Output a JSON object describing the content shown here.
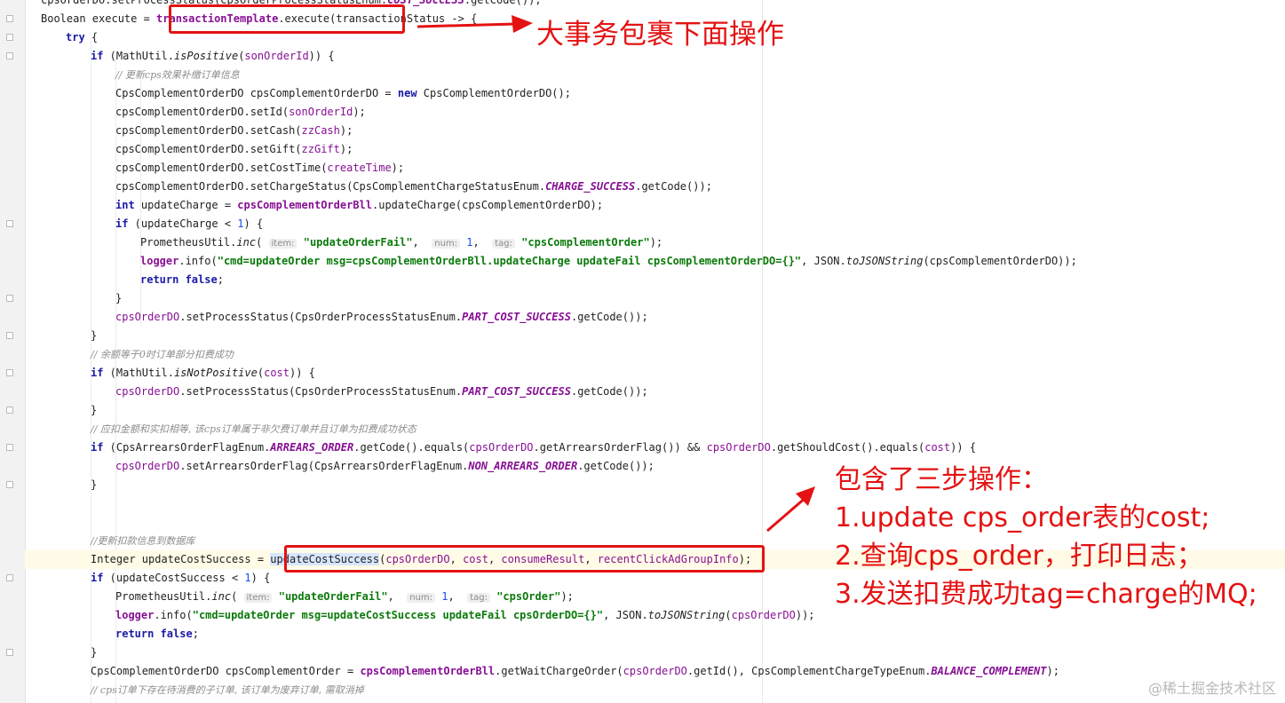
{
  "editor": {
    "lines": [
      {
        "id": "l0",
        "indent": 0,
        "parts": [
          [
            "",
            "cpsOrderDO.setProcessStatus(CpsOrderProcessStatusEnum."
          ],
          [
            "cst",
            "COST_SUCCESS"
          ],
          [
            "",
            ".getCode());"
          ]
        ]
      },
      {
        "id": "l1",
        "indent": 0,
        "parts": [
          [
            "",
            "Boolean execute = "
          ],
          [
            "mem",
            "transactionTemplate"
          ],
          [
            "",
            ".execute(transactionStatus -> {"
          ]
        ]
      },
      {
        "id": "l2",
        "indent": 1,
        "parts": [
          [
            "kw",
            "try"
          ],
          [
            "",
            " {"
          ]
        ]
      },
      {
        "id": "l3",
        "indent": 2,
        "parts": [
          [
            "kw",
            "if"
          ],
          [
            "",
            " (MathUtil."
          ],
          [
            "ita",
            "isPositive"
          ],
          [
            "",
            "("
          ],
          [
            "fld",
            "sonOrderId"
          ],
          [
            "",
            ")) {"
          ]
        ]
      },
      {
        "id": "l4",
        "indent": 3,
        "parts": [
          [
            "cm",
            "// 更新cps效果补缴订单信息"
          ]
        ]
      },
      {
        "id": "l5",
        "indent": 3,
        "parts": [
          [
            "",
            "CpsComplementOrderDO cpsComplementOrderDO = "
          ],
          [
            "kw",
            "new"
          ],
          [
            "",
            " CpsComplementOrderDO();"
          ]
        ]
      },
      {
        "id": "l6",
        "indent": 3,
        "parts": [
          [
            "",
            "cpsComplementOrderDO.setId("
          ],
          [
            "fld",
            "sonOrderId"
          ],
          [
            "",
            ");"
          ]
        ]
      },
      {
        "id": "l7",
        "indent": 3,
        "parts": [
          [
            "",
            "cpsComplementOrderDO.setCash("
          ],
          [
            "fld",
            "zzCash"
          ],
          [
            "",
            ");"
          ]
        ]
      },
      {
        "id": "l8",
        "indent": 3,
        "parts": [
          [
            "",
            "cpsComplementOrderDO.setGift("
          ],
          [
            "fld",
            "zzGift"
          ],
          [
            "",
            ");"
          ]
        ]
      },
      {
        "id": "l9",
        "indent": 3,
        "parts": [
          [
            "",
            "cpsComplementOrderDO.setCostTime("
          ],
          [
            "fld",
            "createTime"
          ],
          [
            "",
            ");"
          ]
        ]
      },
      {
        "id": "l10",
        "indent": 3,
        "parts": [
          [
            "",
            "cpsComplementOrderDO.setChargeStatus(CpsComplementChargeStatusEnum."
          ],
          [
            "cst",
            "CHARGE_SUCCESS"
          ],
          [
            "",
            ".getCode());"
          ]
        ]
      },
      {
        "id": "l11",
        "indent": 3,
        "parts": [
          [
            "kw",
            "int"
          ],
          [
            "",
            " updateCharge = "
          ],
          [
            "mem",
            "cpsComplementOrderBll"
          ],
          [
            "",
            ".updateCharge(cpsComplementOrderDO);"
          ]
        ]
      },
      {
        "id": "l12",
        "indent": 3,
        "parts": [
          [
            "kw",
            "if"
          ],
          [
            "",
            " (updateCharge < "
          ],
          [
            "num",
            "1"
          ],
          [
            "",
            ") {"
          ]
        ]
      },
      {
        "id": "l13",
        "indent": 4,
        "parts": [
          [
            "",
            "PrometheusUtil."
          ],
          [
            "ita",
            "inc"
          ],
          [
            "",
            "( "
          ],
          [
            "hint",
            "item:"
          ],
          [
            "",
            " "
          ],
          [
            "str",
            "\"updateOrderFail\""
          ],
          [
            "",
            ",  "
          ],
          [
            "hint",
            "num:"
          ],
          [
            "",
            " "
          ],
          [
            "num",
            "1"
          ],
          [
            "",
            ",  "
          ],
          [
            "hint",
            "tag:"
          ],
          [
            "",
            " "
          ],
          [
            "str",
            "\"cpsComplementOrder\""
          ],
          [
            "",
            ");"
          ]
        ]
      },
      {
        "id": "l14",
        "indent": 4,
        "parts": [
          [
            "mem",
            "logger"
          ],
          [
            "",
            ".info("
          ],
          [
            "str",
            "\"cmd=updateOrder msg=cpsComplementOrderBll.updateCharge updateFail cpsComplementOrderDO={}\""
          ],
          [
            "",
            ", JSON."
          ],
          [
            "ita",
            "toJSONString"
          ],
          [
            "",
            "(cpsComplementOrderDO));"
          ]
        ]
      },
      {
        "id": "l15",
        "indent": 4,
        "parts": [
          [
            "kw",
            "return false"
          ],
          [
            "",
            ";"
          ]
        ]
      },
      {
        "id": "l16",
        "indent": 3,
        "parts": [
          [
            "",
            "}"
          ]
        ]
      },
      {
        "id": "l17",
        "indent": 3,
        "parts": [
          [
            "fld",
            "cpsOrderDO"
          ],
          [
            "",
            ".setProcessStatus(CpsOrderProcessStatusEnum."
          ],
          [
            "cst",
            "PART_COST_SUCCESS"
          ],
          [
            "",
            ".getCode());"
          ]
        ]
      },
      {
        "id": "l18",
        "indent": 2,
        "parts": [
          [
            "",
            "}"
          ]
        ]
      },
      {
        "id": "l19",
        "indent": 2,
        "parts": [
          [
            "cm",
            "// 余额等于0时订单部分扣费成功"
          ]
        ]
      },
      {
        "id": "l20",
        "indent": 2,
        "parts": [
          [
            "kw",
            "if"
          ],
          [
            "",
            " (MathUtil."
          ],
          [
            "ita",
            "isNotPositive"
          ],
          [
            "",
            "("
          ],
          [
            "fld",
            "cost"
          ],
          [
            "",
            ")) {"
          ]
        ]
      },
      {
        "id": "l21",
        "indent": 3,
        "parts": [
          [
            "fld",
            "cpsOrderDO"
          ],
          [
            "",
            ".setProcessStatus(CpsOrderProcessStatusEnum."
          ],
          [
            "cst",
            "PART_COST_SUCCESS"
          ],
          [
            "",
            ".getCode());"
          ]
        ]
      },
      {
        "id": "l22",
        "indent": 2,
        "parts": [
          [
            "",
            "}"
          ]
        ]
      },
      {
        "id": "l23",
        "indent": 2,
        "parts": [
          [
            "cm",
            "// 应扣金额和实扣相等, 该cps订单属于非欠费订单并且订单为扣费成功状态"
          ]
        ]
      },
      {
        "id": "l24",
        "indent": 2,
        "parts": [
          [
            "kw",
            "if"
          ],
          [
            "",
            " (CpsArrearsOrderFlagEnum."
          ],
          [
            "cst",
            "ARREARS_ORDER"
          ],
          [
            "",
            ".getCode().equals("
          ],
          [
            "fld",
            "cpsOrderDO"
          ],
          [
            "",
            ".getArrearsOrderFlag()) && "
          ],
          [
            "fld",
            "cpsOrderDO"
          ],
          [
            "",
            ".getShouldCost().equals("
          ],
          [
            "fld",
            "cost"
          ],
          [
            "",
            ")) {"
          ]
        ]
      },
      {
        "id": "l25",
        "indent": 3,
        "parts": [
          [
            "fld",
            "cpsOrderDO"
          ],
          [
            "",
            ".setArrearsOrderFlag(CpsArrearsOrderFlagEnum."
          ],
          [
            "cst",
            "NON_ARREARS_ORDER"
          ],
          [
            "",
            ".getCode());"
          ]
        ]
      },
      {
        "id": "l26",
        "indent": 2,
        "parts": [
          [
            "",
            "}"
          ]
        ]
      },
      {
        "id": "l27",
        "indent": 2,
        "parts": []
      },
      {
        "id": "l28",
        "indent": 2,
        "parts": []
      },
      {
        "id": "l29",
        "indent": 2,
        "parts": [
          [
            "cm",
            "//更新扣款信息到数据库"
          ]
        ]
      },
      {
        "id": "l30",
        "indent": 2,
        "current": true,
        "parts": [
          [
            "",
            "Integer updateCostSuccess = "
          ],
          [
            "wordhl",
            "updateCostSuccess"
          ],
          [
            "",
            "("
          ],
          [
            "fld",
            "cpsOrderDO"
          ],
          [
            "",
            ", "
          ],
          [
            "fld",
            "cost"
          ],
          [
            "",
            ", "
          ],
          [
            "fld",
            "consumeResult"
          ],
          [
            "",
            ", "
          ],
          [
            "fld",
            "recentClickAdGroupInfo"
          ],
          [
            "",
            ");"
          ]
        ]
      },
      {
        "id": "l31",
        "indent": 2,
        "parts": [
          [
            "kw",
            "if"
          ],
          [
            "",
            " (updateCostSuccess < "
          ],
          [
            "num",
            "1"
          ],
          [
            "",
            ") {"
          ]
        ]
      },
      {
        "id": "l32",
        "indent": 3,
        "parts": [
          [
            "",
            "PrometheusUtil."
          ],
          [
            "ita",
            "inc"
          ],
          [
            "",
            "( "
          ],
          [
            "hint",
            "item:"
          ],
          [
            "",
            " "
          ],
          [
            "str",
            "\"updateOrderFail\""
          ],
          [
            "",
            ",  "
          ],
          [
            "hint",
            "num:"
          ],
          [
            "",
            " "
          ],
          [
            "num",
            "1"
          ],
          [
            "",
            ",  "
          ],
          [
            "hint",
            "tag:"
          ],
          [
            "",
            " "
          ],
          [
            "str",
            "\"cpsOrder\""
          ],
          [
            "",
            ");"
          ]
        ]
      },
      {
        "id": "l33",
        "indent": 3,
        "parts": [
          [
            "mem",
            "logger"
          ],
          [
            "",
            ".info("
          ],
          [
            "str",
            "\"cmd=updateOrder msg=updateCostSuccess updateFail cpsOrderDO={}\""
          ],
          [
            "",
            ", JSON."
          ],
          [
            "ita",
            "toJSONString"
          ],
          [
            "",
            "("
          ],
          [
            "fld",
            "cpsOrderDO"
          ],
          [
            "",
            "));"
          ]
        ]
      },
      {
        "id": "l34",
        "indent": 3,
        "parts": [
          [
            "kw",
            "return false"
          ],
          [
            "",
            ";"
          ]
        ]
      },
      {
        "id": "l35",
        "indent": 2,
        "parts": [
          [
            "",
            "}"
          ]
        ]
      },
      {
        "id": "l36",
        "indent": 2,
        "parts": [
          [
            "",
            "CpsComplementOrderDO cpsComplementOrder = "
          ],
          [
            "mem",
            "cpsComplementOrderBll"
          ],
          [
            "",
            ".getWaitChargeOrder("
          ],
          [
            "fld",
            "cpsOrderDO"
          ],
          [
            "",
            ".getId(), CpsComplementChargeTypeEnum."
          ],
          [
            "cst",
            "BALANCE_COMPLEMENT"
          ],
          [
            "",
            ");"
          ]
        ]
      },
      {
        "id": "l37",
        "indent": 2,
        "parts": [
          [
            "cm",
            "// cps订单下存在待消费的子订单, 该订单为废弃订单, 需取消掉"
          ]
        ]
      }
    ]
  },
  "annotations": {
    "top": "大事务包裹下面操作",
    "steps_title": "包含了三步操作：",
    "step1": "1.update cps_order表的cost;",
    "step2": "2.查询cps_order，打印日志；",
    "step3": "3.发送扣费成功tag=charge的MQ;",
    "colors": {
      "annotation": "#e41212",
      "highlight_line": "#fffbe6"
    }
  },
  "watermark": "@稀土掘金技术社区"
}
